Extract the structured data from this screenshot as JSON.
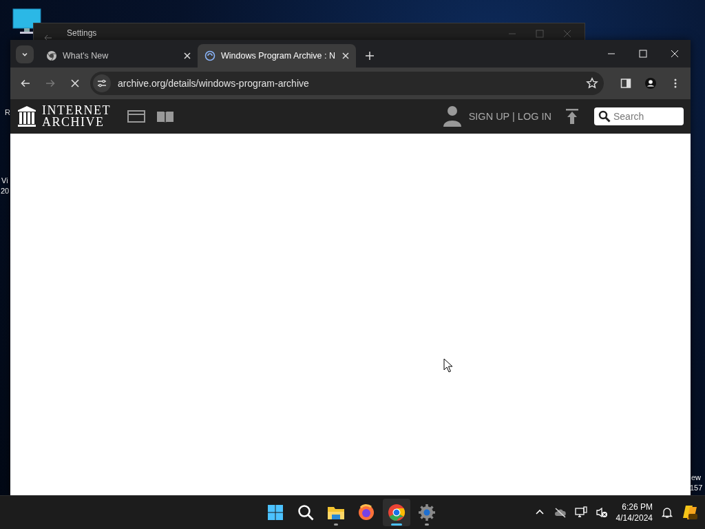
{
  "desktop": {
    "left_labels": [
      "R",
      "Vi",
      "20"
    ],
    "right_labels": [
      "ew",
      "157"
    ]
  },
  "background_window": {
    "title": "Settings"
  },
  "browser": {
    "tabs": [
      {
        "title": "What's New",
        "selected": false
      },
      {
        "title": "Windows Program Archive : N",
        "selected": true
      }
    ],
    "address": "archive.org/details/windows-program-archive",
    "loading": true
  },
  "site": {
    "logo_lines": [
      "INTERNET",
      "ARCHIVE"
    ],
    "account": "SIGN UP | LOG IN",
    "search": {
      "placeholder": "Search"
    }
  },
  "taskbar": {
    "apps": [
      {
        "kind": "start",
        "running": false,
        "selected": false
      },
      {
        "kind": "search",
        "running": false,
        "selected": false
      },
      {
        "kind": "files",
        "running": true,
        "selected": false
      },
      {
        "kind": "firefox",
        "running": false,
        "selected": false
      },
      {
        "kind": "chrome",
        "running": true,
        "selected": true
      },
      {
        "kind": "settings",
        "running": true,
        "selected": false
      }
    ],
    "time": "6:26 PM",
    "date": "4/14/2024"
  }
}
